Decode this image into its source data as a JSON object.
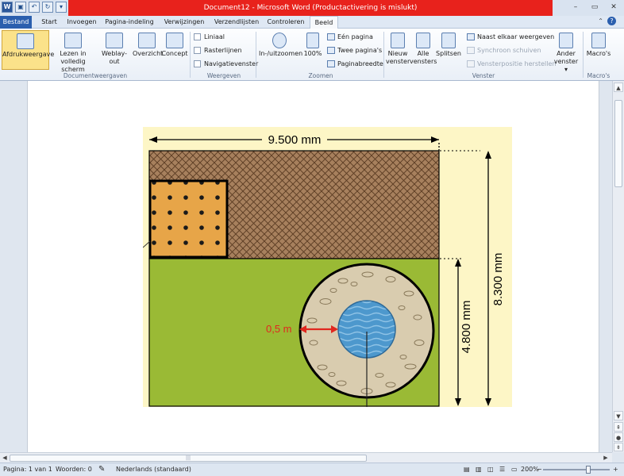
{
  "window": {
    "title": "Document12 - Microsoft Word (Productactivering is mislukt)"
  },
  "tabs": [
    "Bestand",
    "Start",
    "Invoegen",
    "Pagina-indeling",
    "Verwijzingen",
    "Verzendlijsten",
    "Controleren",
    "Beeld"
  ],
  "ribbon": {
    "documentweergaven": {
      "label": "Documentweergaven",
      "afdrukweergave": "Afdrukweergave",
      "lezen_line1": "Lezen in",
      "lezen_line2": "volledig scherm",
      "weblayout": "Weblay-out",
      "overzicht": "Overzicht",
      "concept": "Concept"
    },
    "weergeven": {
      "label": "Weergeven",
      "liniaal": "Liniaal",
      "rasterlijnen": "Rasterlijnen",
      "navigatievenster": "Navigatievenster"
    },
    "zoomen": {
      "label": "Zoomen",
      "in_uitzoomen": "In-/uitzoomen",
      "pct100": "100%",
      "een_pagina": "Eén pagina",
      "twee_paginas": "Twee pagina's",
      "paginabreedte": "Paginabreedte"
    },
    "venster": {
      "label": "Venster",
      "nieuw_line1": "Nieuw",
      "nieuw_line2": "venster",
      "alle_line1": "Alle",
      "alle_line2": "vensters",
      "splitsen": "Splitsen",
      "naast_elkaar": "Naast elkaar weergeven",
      "synchroon": "Synchroon schuiven",
      "vensterpositie": "Vensterpositie herstellen",
      "ander_line1": "Ander",
      "ander_line2": "venster"
    },
    "macros": {
      "label": "Macro's",
      "button": "Macro's"
    }
  },
  "figure": {
    "width_label": "9.500 mm",
    "height_label": "8.300 mm",
    "lower_height_label": "4.800 mm",
    "distance_label": "0,5 m"
  },
  "statusbar": {
    "pagina": "Pagina: 1 van 1",
    "woorden": "Woorden: 0",
    "taal": "Nederlands (standaard)",
    "zoom": "200%"
  },
  "colors": {
    "accent": "#2b5fae",
    "titlebar_red": "#e8221c",
    "selected_button": "#fbe28a",
    "lawn": "#9aba35",
    "terrace": "#a7805d",
    "sandbox": "#e7a548",
    "water": "#4d98cd",
    "gravel": "#d9ccaf",
    "background": "#fdf6c6",
    "arrow_red": "#e0271f"
  }
}
